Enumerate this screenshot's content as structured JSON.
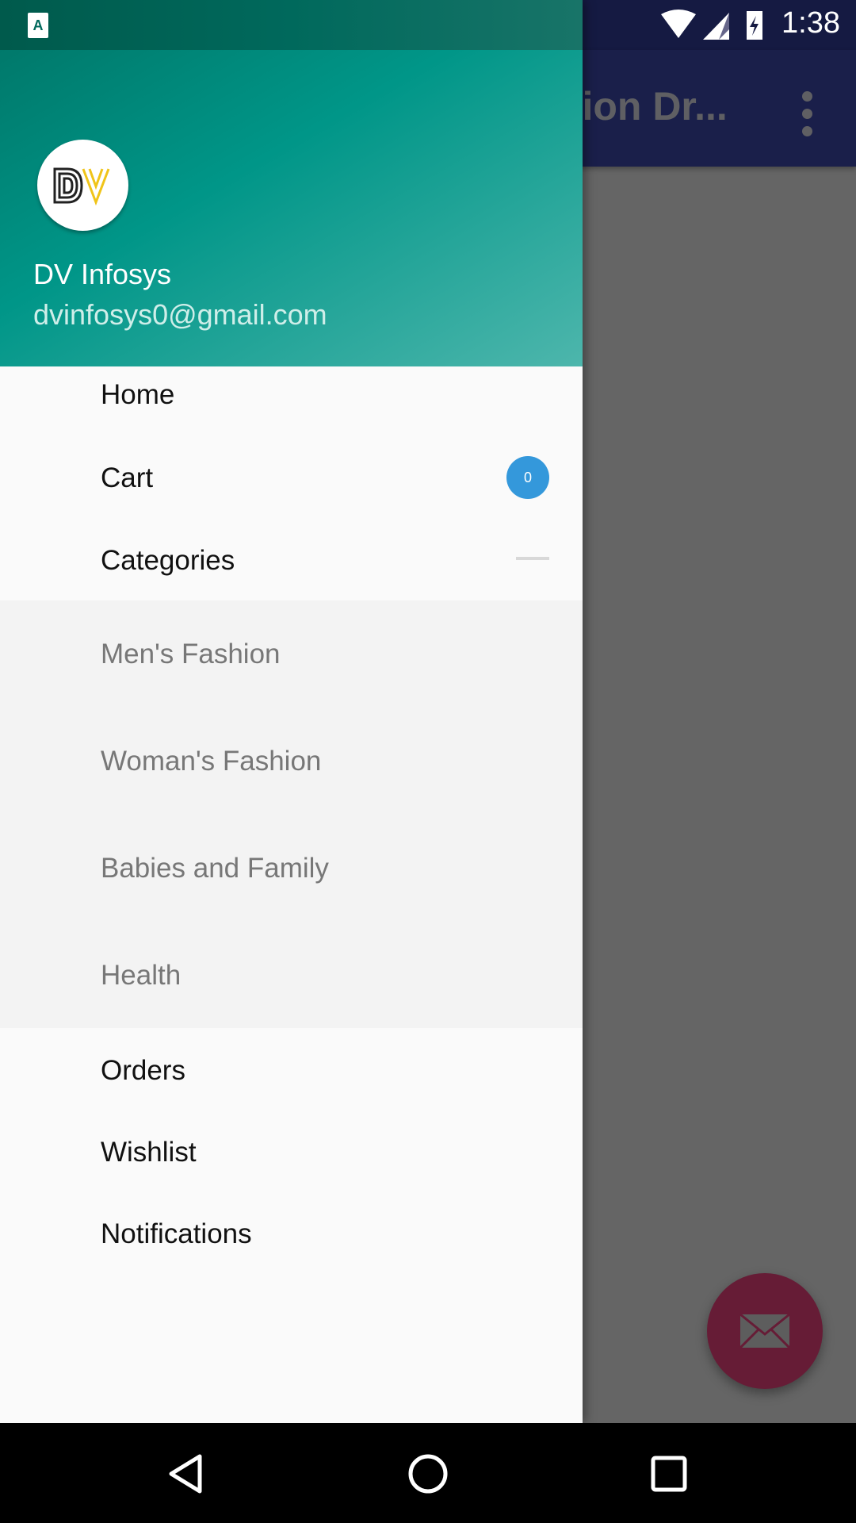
{
  "status_bar": {
    "time": "1:38",
    "icons": [
      "accessibility-app-icon",
      "wifi-icon",
      "signal-icon",
      "battery-charging-icon"
    ]
  },
  "toolbar": {
    "title": "ation Dr...",
    "menu_icon": "more-vert-icon"
  },
  "drawer": {
    "user": {
      "name": "DV Infosys",
      "email": "dvinfosys0@gmail.com",
      "avatar_logo": "DV"
    },
    "items_top": [
      {
        "label": "Home"
      },
      {
        "label": "Cart",
        "badge": "0"
      },
      {
        "label": "Categories",
        "expanded": true
      }
    ],
    "sub_items": [
      {
        "label": "Men's Fashion"
      },
      {
        "label": "Woman's Fashion"
      },
      {
        "label": "Babies and Family"
      },
      {
        "label": "Health"
      }
    ],
    "items_bottom": [
      {
        "label": "Orders"
      },
      {
        "label": "Wishlist"
      },
      {
        "label": "Notifications"
      }
    ]
  },
  "fab": {
    "icon": "mail-icon",
    "color": "#661c36"
  },
  "colors": {
    "header_start": "#00796b",
    "header_end": "#4db6ac",
    "badge": "#3498db",
    "toolbar": "#1a1f4a"
  },
  "nav_bar": {
    "icons": [
      "back-icon",
      "home-icon",
      "recents-icon"
    ]
  }
}
